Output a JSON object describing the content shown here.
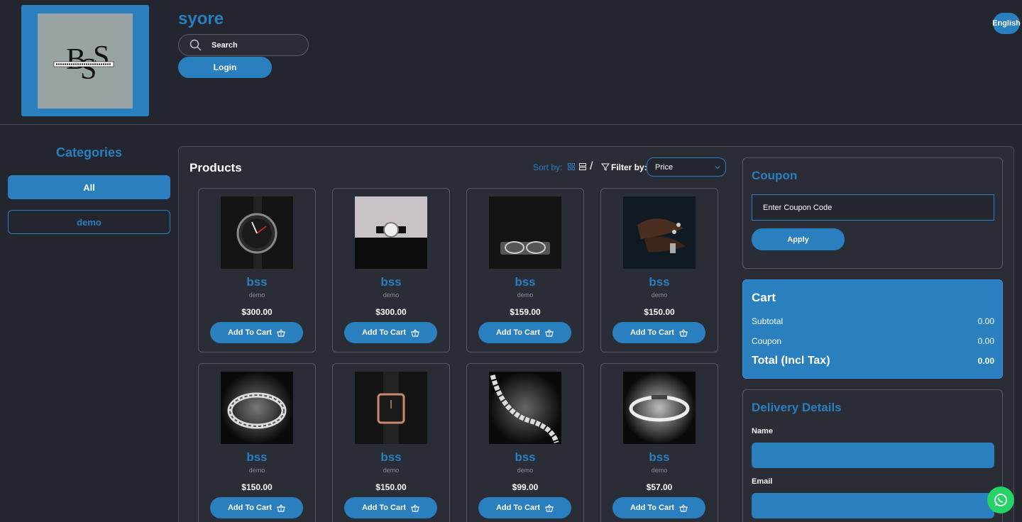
{
  "store": {
    "name": "syore",
    "logo_alt": "BSS Men's Accessories"
  },
  "header": {
    "search_label": "Search",
    "login_label": "Login",
    "language_label": "English"
  },
  "categories": {
    "title": "Categories",
    "items": [
      {
        "label": "All",
        "active": true
      },
      {
        "label": "demo",
        "active": false
      }
    ]
  },
  "products_section": {
    "title": "Products",
    "sort_label": "Sort by:",
    "filter_label": "Filter by:",
    "filter_value": "Price",
    "add_to_cart_label": "Add To Cart"
  },
  "products": [
    {
      "name": "bss",
      "category": "demo",
      "price": "$300.00",
      "image": "watch-dark"
    },
    {
      "name": "bss",
      "category": "demo",
      "price": "$300.00",
      "image": "watch-white"
    },
    {
      "name": "bss",
      "category": "demo",
      "price": "$159.00",
      "image": "glasses"
    },
    {
      "name": "bss",
      "category": "demo",
      "price": "$150.00",
      "image": "hands-rings"
    },
    {
      "name": "bss",
      "category": "demo",
      "price": "$150.00",
      "image": "bracelet-cuff"
    },
    {
      "name": "bss",
      "category": "demo",
      "price": "$150.00",
      "image": "watch-gold"
    },
    {
      "name": "bss",
      "category": "demo",
      "price": "$99.00",
      "image": "chain"
    },
    {
      "name": "bss",
      "category": "demo",
      "price": "$57.00",
      "image": "bracelet-silver"
    }
  ],
  "coupon": {
    "title": "Coupon",
    "placeholder": "Enter Coupon Code",
    "apply_label": "Apply"
  },
  "cart": {
    "title": "Cart",
    "subtotal_label": "Subtotal",
    "subtotal_value": "0.00",
    "coupon_label": "Coupon",
    "coupon_value": "0.00",
    "total_label": "Total (Incl Tax)",
    "total_value": "0.00"
  },
  "delivery": {
    "title": "Delivery Details",
    "name_label": "Name",
    "email_label": "Email"
  },
  "colors": {
    "accent": "#2a7fbf",
    "background": "#23252f",
    "whatsapp": "#25d366"
  }
}
